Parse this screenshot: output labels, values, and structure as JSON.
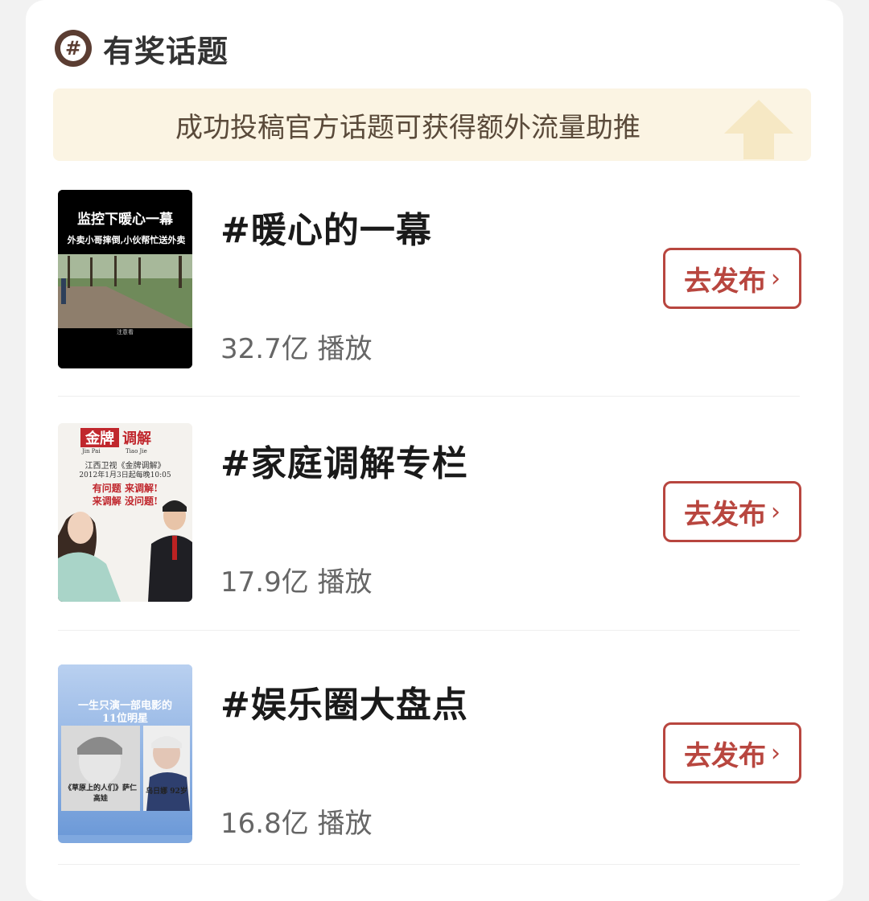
{
  "header": {
    "title": "有奖话题",
    "icon": "hashtag-icon"
  },
  "banner": {
    "text": "成功投稿官方话题可获得额外流量助推"
  },
  "topics": [
    {
      "title": "#暖心的一幕",
      "plays": "32.7亿 播放",
      "button": "去发布",
      "thumb": {
        "headline": "监控下暖心一幕",
        "subline": "外卖小哥摔倒,小伙帮忙送外卖",
        "footer": "注意看"
      }
    },
    {
      "title": "#家庭调解专栏",
      "plays": "17.9亿 播放",
      "button": "去发布",
      "thumb": {
        "logo_a": "金牌",
        "logo_b": "调解",
        "pinyin_a": "Jin Pai",
        "pinyin_b": "Tiao Jie",
        "channel": "江西卫视《金牌调解》",
        "schedule": "2012年1月3日起每晚10:05",
        "slogan_a": "有问题 来调解!",
        "slogan_b": "来调解 没问题!"
      }
    },
    {
      "title": "#娱乐圈大盘点",
      "plays": "16.8亿 播放",
      "button": "去发布",
      "thumb": {
        "headline_a": "一生只演一部电影的",
        "headline_b": "11位明星",
        "caption_left": "《草原上的人们》萨仁高娃",
        "caption_right": "乌日娜 92岁"
      }
    }
  ],
  "colors": {
    "accent": "#b8463f",
    "icon": "#5b3d32",
    "banner_bg": "#fbf4e3"
  }
}
